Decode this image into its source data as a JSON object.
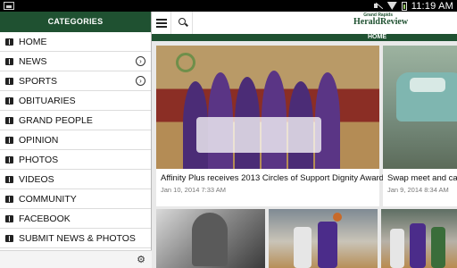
{
  "status": {
    "time": "11:19 AM"
  },
  "drawer": {
    "header": "CATEGORIES",
    "items": [
      {
        "label": "HOME",
        "chevron": false
      },
      {
        "label": "NEWS",
        "chevron": true
      },
      {
        "label": "SPORTS",
        "chevron": true
      },
      {
        "label": "OBITUARIES",
        "chevron": false
      },
      {
        "label": "GRAND PEOPLE",
        "chevron": false
      },
      {
        "label": "OPINION",
        "chevron": false
      },
      {
        "label": "PHOTOS",
        "chevron": false
      },
      {
        "label": "VIDEOS",
        "chevron": false
      },
      {
        "label": "COMMUNITY",
        "chevron": false
      },
      {
        "label": "FACEBOOK",
        "chevron": false
      },
      {
        "label": "SUBMIT NEWS & PHOTOS",
        "chevron": false
      }
    ]
  },
  "header": {
    "logo_top": "Grand Rapids",
    "logo_name": "HeraldReview",
    "logo_url": "GrandRapidsMN.com",
    "section": "HOME"
  },
  "articles": [
    {
      "title": "Affinity Plus receives 2013 Circles of Support Dignity Award",
      "date": "Jan 10, 2014 7:33 AM"
    },
    {
      "title": "Swap meet and car s",
      "date": "Jan 9, 2014 8:34 AM"
    }
  ],
  "icons": {
    "menu": "hamburger-icon",
    "search": "search-icon",
    "settings": "gear-icon",
    "chevron": "chevron-right-icon"
  },
  "colors": {
    "brand": "#1f5131",
    "background": "#e9e9e9"
  }
}
